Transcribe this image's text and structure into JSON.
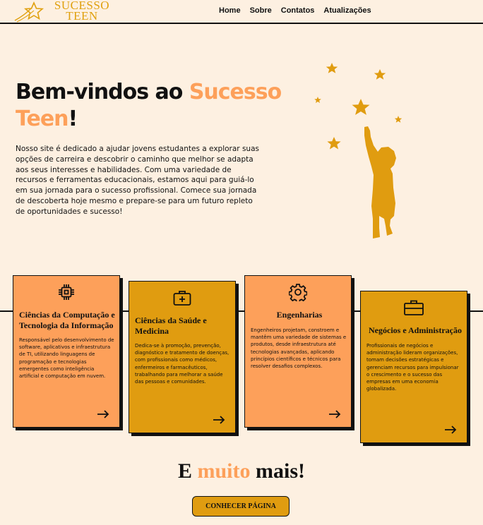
{
  "brand": {
    "line1": "SUCESSO",
    "line2": "TEEN"
  },
  "nav": [
    {
      "label": "Home"
    },
    {
      "label": "Sobre"
    },
    {
      "label": "Contatos"
    },
    {
      "label": "Atualizações"
    }
  ],
  "hero": {
    "title_prefix": "Bem-vindos ao ",
    "title_accent": "Sucesso Teen",
    "title_suffix": "!",
    "text": "Nosso site é dedicado a ajudar jovens estudantes a explorar suas opções de carreira e descobrir o caminho que melhor se adapta aos seus interesses e habilidades. Com uma variedade de recursos e ferramentas educacionais, estamos aqui para guiá-lo em sua jornada para o sucesso profissional. Comece sua jornada de descoberta hoje mesmo e prepare-se para um futuro repleto de oportunidades e sucesso!"
  },
  "cards": [
    {
      "icon": "chip-icon",
      "title": "Ciências da Computação e Tecnologia da Informação",
      "text": "Responsável pelo desenvolvimento de software, aplicativos e infraestrutura de TI, utilizando linguagens de programação e tecnologias emergentes como inteligência artificial e computação em nuvem."
    },
    {
      "icon": "medkit-icon",
      "title": "Ciências da Saúde e Medicina",
      "text": "Dedica-se à promoção, prevenção, diagnóstico e tratamento de doenças, com profissionais como médicos, enfermeiros e farmacêuticos, trabalhando para melhorar a saúde das pessoas e comunidades."
    },
    {
      "icon": "gear-icon",
      "title": "Engenharias",
      "text": "Engenheiros projetam, constroem e mantêm uma variedade de sistemas e produtos, desde infraestrutura até tecnologias avançadas, aplicando princípios científicos e técnicos para resolver desafios complexos."
    },
    {
      "icon": "briefcase-icon",
      "title": "Negócios e Administração",
      "text": "Profissionais de negócios e administração lideram organizações, tomam decisões estratégicas e gerenciam recursos para impulsionar o crescimento e o sucesso das empresas em uma economia globalizada."
    }
  ],
  "more": {
    "prefix": "E ",
    "accent": "muito",
    "suffix": " mais!"
  },
  "cta": {
    "label": "CONHECER PÁGINA"
  },
  "colors": {
    "background": "#fdf0e1",
    "accent_orange": "#fda05a",
    "accent_gold": "#e09c10",
    "ink": "#111111"
  }
}
